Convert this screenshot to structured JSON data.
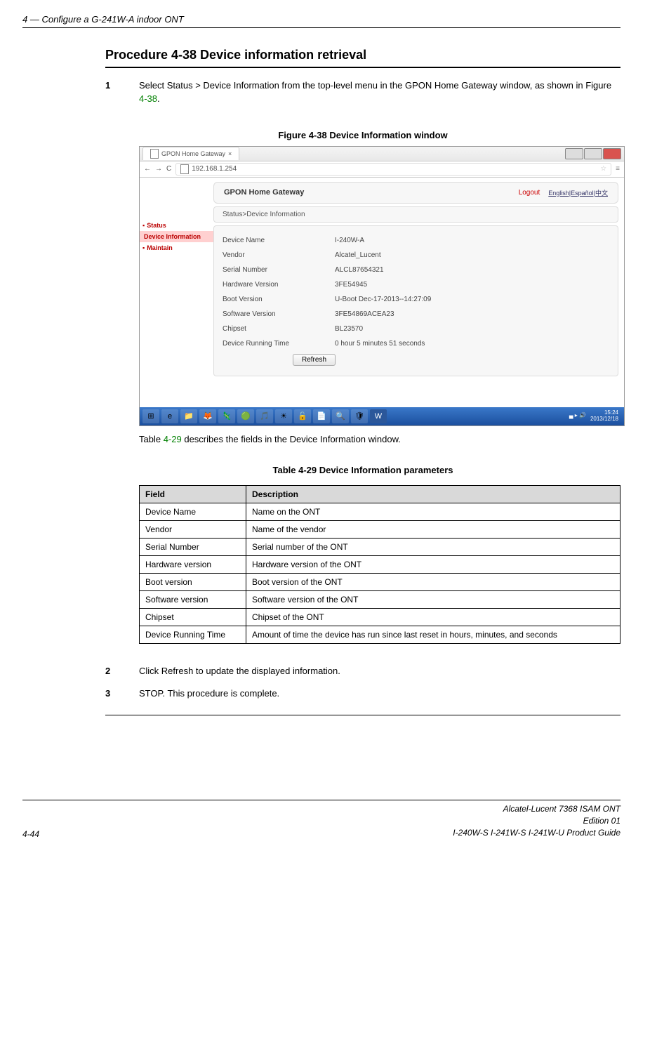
{
  "header": "4 —  Configure a G-241W-A indoor ONT",
  "procedure_title": "Procedure 4-38  Device information retrieval",
  "step1": {
    "num": "1",
    "text_a": "Select Status > Device Information from the top-level menu in the GPON Home Gateway window, as shown in Figure ",
    "link": "4-38",
    "text_b": "."
  },
  "figure_caption": "Figure 4-38  Device Information window",
  "screenshot": {
    "tab_title": "GPON Home Gateway",
    "url": "192.168.1.254",
    "nav": {
      "back": "←",
      "fwd": "→",
      "reload": "C"
    },
    "sidebar": {
      "status": "Status",
      "devinfo": "Device Information",
      "maintain": "Maintain"
    },
    "banner_title": "GPON Home Gateway",
    "logout": "Logout",
    "langs": "English|Español|中文",
    "breadcrumb": "Status>Device Information",
    "rows": [
      {
        "label": "Device Name",
        "value": "I-240W-A"
      },
      {
        "label": "Vendor",
        "value": "Alcatel_Lucent"
      },
      {
        "label": "Serial Number",
        "value": "ALCL87654321"
      },
      {
        "label": "Hardware Version",
        "value": "3FE54945"
      },
      {
        "label": "Boot Version",
        "value": "U-Boot Dec-17-2013--14:27:09"
      },
      {
        "label": "Software Version",
        "value": "3FE54869ACEA23"
      },
      {
        "label": "Chipset",
        "value": "BL23570"
      },
      {
        "label": "Device Running Time",
        "value": "0 hour 5 minutes 51 seconds"
      }
    ],
    "refresh": "Refresh",
    "taskbar": {
      "icons": [
        "⊞",
        "e",
        "📁",
        "🦊",
        "🦎",
        "🟢",
        "🎵",
        "☀",
        "🔓",
        "📄",
        "🔍",
        "🛡",
        "W"
      ],
      "time": "15:24",
      "date": "2013/12/18"
    }
  },
  "after_figure": {
    "a": "Table ",
    "link": "4-29",
    "b": " describes the fields in the Device Information window."
  },
  "table_caption": "Table 4-29 Device Information parameters",
  "table": {
    "h1": "Field",
    "h2": "Description",
    "rows": [
      {
        "f": "Device Name",
        "d": "Name on the ONT"
      },
      {
        "f": "Vendor",
        "d": "Name of the vendor"
      },
      {
        "f": "Serial Number",
        "d": "Serial number of the ONT"
      },
      {
        "f": "Hardware version",
        "d": "Hardware version of the ONT"
      },
      {
        "f": "Boot version",
        "d": "Boot version of the ONT"
      },
      {
        "f": "Software version",
        "d": "Software version of the ONT"
      },
      {
        "f": "Chipset",
        "d": "Chipset of the ONT"
      },
      {
        "f": "Device Running Time",
        "d": "Amount of time the device has run since last reset in hours, minutes, and seconds"
      }
    ]
  },
  "step2": {
    "num": "2",
    "text": "Click Refresh to update the displayed information."
  },
  "step3": {
    "num": "3",
    "text": "STOP. This procedure is complete."
  },
  "footer": {
    "left": "4-44",
    "r1": "Alcatel-Lucent 7368 ISAM ONT",
    "r2": "Edition 01",
    "r3": "I-240W-S I-241W-S I-241W-U Product Guide"
  }
}
